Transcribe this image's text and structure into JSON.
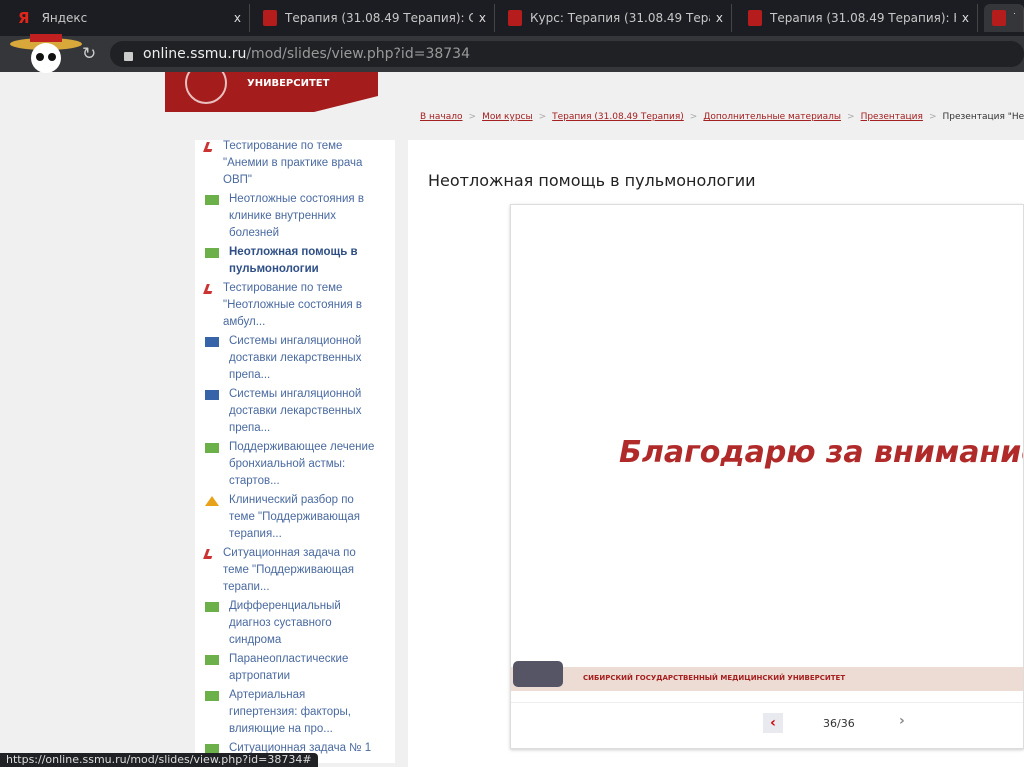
{
  "tabs": [
    {
      "title": "Яндекс",
      "icon": "yandex-icon"
    },
    {
      "title": "Терапия (31.08.49 Терапия): С",
      "icon": "ssmu-icon"
    },
    {
      "title": "Курс: Терапия (31.08.49 Терап",
      "icon": "ssmu-icon"
    },
    {
      "title": "Терапия (31.08.49 Терапия): Н",
      "icon": "ssmu-icon"
    },
    {
      "title": "Т",
      "icon": "ssmu-icon"
    }
  ],
  "tab_close": "x",
  "url": {
    "host": "online.ssmu.ru",
    "path": "/mod/slides/view.php?id=38734"
  },
  "logo": {
    "text": "УНИВЕРСИТЕТ"
  },
  "breadcrumb": [
    "В начало",
    "Мои курсы",
    "Терапия (31.08.49 Терапия)",
    "Дополнительные материалы",
    "Презентация"
  ],
  "breadcrumb_current": "Презентация \"Нео",
  "breadcrumb_sep": ">",
  "sidebar": [
    {
      "type": "quiz",
      "label": "Тестирование по теме \"Анемии в практике врача ОВП\""
    },
    {
      "type": "slide",
      "label": "Неотложные состояния в клинике внутренних болезней"
    },
    {
      "type": "slide",
      "label": "Неотложная помощь в пульмонологии",
      "current": true
    },
    {
      "type": "quiz",
      "label": "Тестирование по теме \"Неотложные состояния в амбул..."
    },
    {
      "type": "video",
      "label": "Системы ингаляционной доставки лекарственных препа..."
    },
    {
      "type": "video",
      "label": "Системы ингаляционной доставки лекарственных препа..."
    },
    {
      "type": "slide",
      "label": "Поддерживающее лечение бронхиальной астмы: стартов..."
    },
    {
      "type": "case",
      "label": "Клинический разбор по теме \"Поддерживающая терапия..."
    },
    {
      "type": "quiz",
      "label": "Ситуационная задача по теме \"Поддерживающая терапи..."
    },
    {
      "type": "slide",
      "label": "Дифференциальный диагноз суставного синдрома"
    },
    {
      "type": "slide",
      "label": "Паранеопластические артропатии"
    },
    {
      "type": "slide",
      "label": "Артериальная гипертензия: факторы, влияющие на про..."
    },
    {
      "type": "slide",
      "label": "Ситуационная задача № 1"
    }
  ],
  "main": {
    "title": "Неотложная помощь в пульмонологии",
    "slide_text": "Благодарю за внимание!",
    "slide_footer": "СИБИРСКИЙ ГОСУДАРСТВЕННЫЙ МЕДИЦИНСКИЙ УНИВЕРСИТЕТ",
    "prev": "‹",
    "next": "›",
    "page": "36/36"
  },
  "status_url": "https://online.ssmu.ru/mod/slides/view.php?id=38734#"
}
